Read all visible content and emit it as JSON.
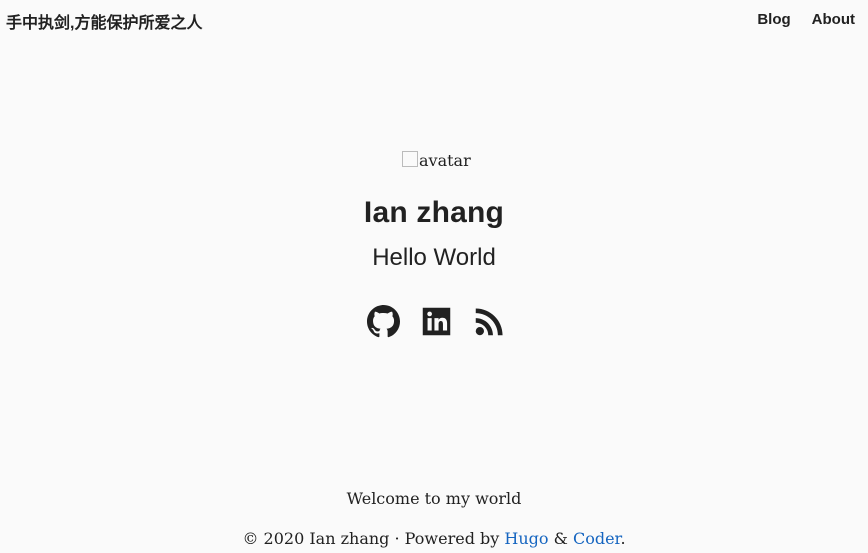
{
  "nav": {
    "site_title": "手中执剑,方能保护所爱之人",
    "links": [
      "Blog",
      "About"
    ]
  },
  "profile": {
    "avatar_alt": "avatar",
    "name": "Ian zhang",
    "subtitle": "Hello World"
  },
  "social": {
    "icons": [
      "github-icon",
      "linkedin-icon",
      "rss-icon"
    ]
  },
  "footer": {
    "welcome": "Welcome to my world",
    "copyright_prefix": "© 2020 Ian zhang · Powered by",
    "hugo": "Hugo",
    "amp": "&",
    "coder": "Coder",
    "period": "."
  },
  "colors": {
    "background": "#fafafa",
    "text": "#212121",
    "link": "#1565c0"
  }
}
